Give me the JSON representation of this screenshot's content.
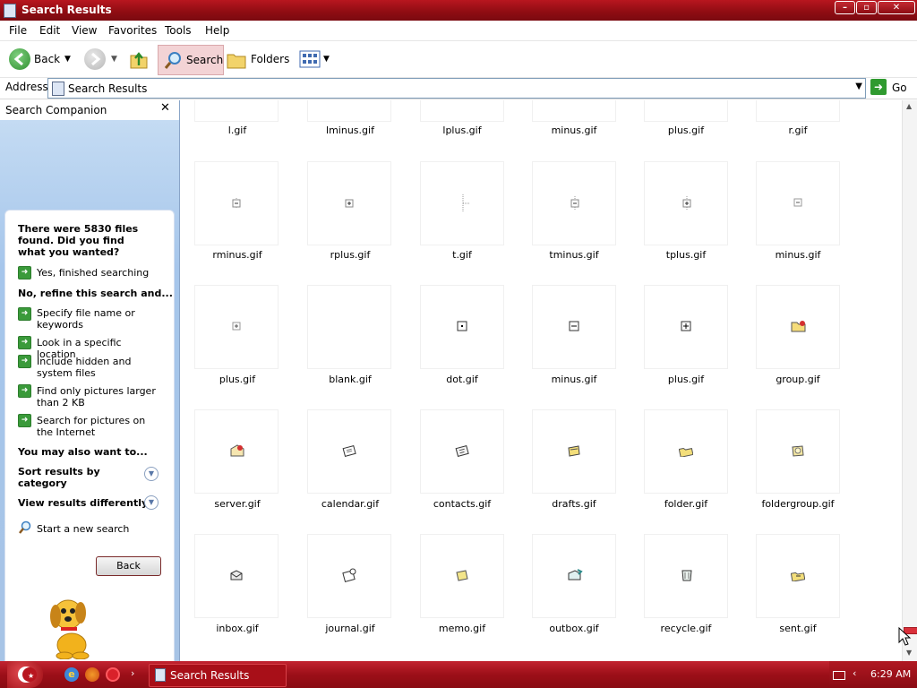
{
  "window": {
    "title": "Search Results"
  },
  "menu": [
    "File",
    "Edit",
    "View",
    "Favorites",
    "Tools",
    "Help"
  ],
  "toolbar": {
    "back": "Back",
    "search": "Search",
    "folders": "Folders"
  },
  "address": {
    "label": "Address",
    "value": "Search Results",
    "go": "Go"
  },
  "sidebar": {
    "title": "Search Companion",
    "found": "There were 5830 files found. Did you find what you wanted?",
    "yes": "Yes, finished searching",
    "refine": "No, refine this search and...",
    "options": [
      "Specify file name or keywords",
      "Look in a specific location",
      "Include hidden and system files",
      "Find only pictures larger than 2 KB",
      "Search for pictures on the Internet"
    ],
    "also": "You may also want to...",
    "sort": "Sort results by category",
    "view": "View results differently",
    "newsearch": "Start a new search",
    "back": "Back"
  },
  "files": [
    [
      "l.gif",
      "lminus.gif",
      "lplus.gif",
      "minus.gif",
      "plus.gif",
      "r.gif"
    ],
    [
      "rminus.gif",
      "rplus.gif",
      "t.gif",
      "tminus.gif",
      "tplus.gif",
      "minus.gif"
    ],
    [
      "plus.gif",
      "blank.gif",
      "dot.gif",
      "minus.gif",
      "plus.gif",
      "group.gif"
    ],
    [
      "server.gif",
      "calendar.gif",
      "contacts.gif",
      "drafts.gif",
      "folder.gif",
      "foldergroup.gif"
    ],
    [
      "inbox.gif",
      "journal.gif",
      "memo.gif",
      "outbox.gif",
      "recycle.gif",
      "sent.gif"
    ]
  ],
  "taskbar": {
    "item": "Search Results",
    "time": "6:29 AM"
  }
}
